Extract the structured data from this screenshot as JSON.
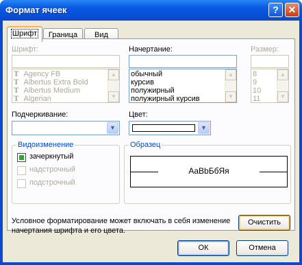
{
  "window": {
    "title": "Формат ячеек",
    "help_glyph": "?",
    "close_glyph": "✕"
  },
  "tabs": [
    {
      "label": "Шрифт",
      "active": true
    },
    {
      "label": "Граница"
    },
    {
      "label": "Вид"
    }
  ],
  "font": {
    "label": "Шрифт:",
    "value": "",
    "items": [
      "Agency FB",
      "Albertus Extra Bold",
      "Albertus Medium",
      "Algerian"
    ],
    "item_icon": "truetype-icon"
  },
  "style": {
    "label": "Начертание:",
    "value": "",
    "items": [
      "обычный",
      "курсив",
      "полужирный",
      "полужирный курсив"
    ]
  },
  "size": {
    "label": "Размер:",
    "value": "",
    "items": [
      "8",
      "9",
      "10",
      "11"
    ]
  },
  "underline": {
    "label": "Подчеркивание:",
    "value": ""
  },
  "color": {
    "label": "Цвет:",
    "swatch": "#ffffff"
  },
  "effects": {
    "title": "Видоизменение",
    "items": [
      {
        "label": "зачеркнутый",
        "state": "indeterminate",
        "enabled": true
      },
      {
        "label": "надстрочный",
        "state": "unchecked",
        "enabled": false
      },
      {
        "label": "подстрочный",
        "state": "unchecked",
        "enabled": false
      }
    ]
  },
  "preview": {
    "title": "Образец",
    "sample": "AaBbБбЯя"
  },
  "note": "Условное форматирование может включать в себя изменение начертания шрифта и его цвета.",
  "buttons": {
    "clear": "Очистить",
    "ok": "ОК",
    "cancel": "Отмена"
  },
  "colors": {
    "accent": "#0046d5",
    "title_bar": "#0552d9",
    "dialog_bg": "#ece9d8"
  }
}
